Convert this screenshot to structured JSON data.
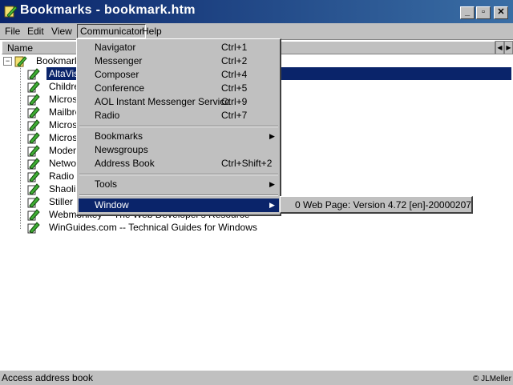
{
  "window": {
    "title": "Bookmarks - bookmark.htm",
    "controls": {
      "minimize": "_",
      "maximize": "▫",
      "close": "✕"
    }
  },
  "menubar": {
    "items": [
      {
        "label": "File"
      },
      {
        "label": "Edit"
      },
      {
        "label": "View"
      },
      {
        "label": "Communicator"
      },
      {
        "label": "Help"
      }
    ]
  },
  "content": {
    "column_header": "Name",
    "tree": [
      {
        "label": "Bookmarks",
        "root": true
      },
      {
        "label": "AltaVista",
        "selected": true
      },
      {
        "label": "Children"
      },
      {
        "label": "Micros"
      },
      {
        "label": "Mailbre"
      },
      {
        "label": "Micros"
      },
      {
        "label": "Micros"
      },
      {
        "label": "Moden"
      },
      {
        "label": "Netwo"
      },
      {
        "label": "Radio"
      },
      {
        "label": "Shaolin"
      },
      {
        "label": "Stiller H"
      },
      {
        "label": "Webmonkey -- The Web Developer's Resource"
      },
      {
        "label": "WinGuides.com -- Technical Guides for Windows"
      }
    ]
  },
  "communicator_menu": {
    "items": [
      {
        "label": "Navigator",
        "shortcut": "Ctrl+1"
      },
      {
        "label": "Messenger",
        "shortcut": "Ctrl+2"
      },
      {
        "label": "Composer",
        "shortcut": "Ctrl+4"
      },
      {
        "label": "Conference",
        "shortcut": "Ctrl+5"
      },
      {
        "label": "AOL Instant Messenger Service",
        "shortcut": "Ctrl+9"
      },
      {
        "label": "Radio",
        "shortcut": "Ctrl+7"
      },
      {
        "label": "Bookmarks",
        "submenu": true
      },
      {
        "label": "Newsgroups"
      },
      {
        "label": "Address Book",
        "shortcut": "Ctrl+Shift+2"
      },
      {
        "label": "Tools",
        "submenu": true
      },
      {
        "label": "Window",
        "submenu": true,
        "highlighted": true
      }
    ],
    "window_submenu": {
      "item": "0 Web Page: Version 4.72 [en]-20000207"
    }
  },
  "statusbar": {
    "text": "Access address book",
    "credit": "© JLMeller"
  },
  "colors": {
    "titlebar": "#0a246a",
    "highlight": "#0a246a",
    "face": "#c0c0c0"
  }
}
